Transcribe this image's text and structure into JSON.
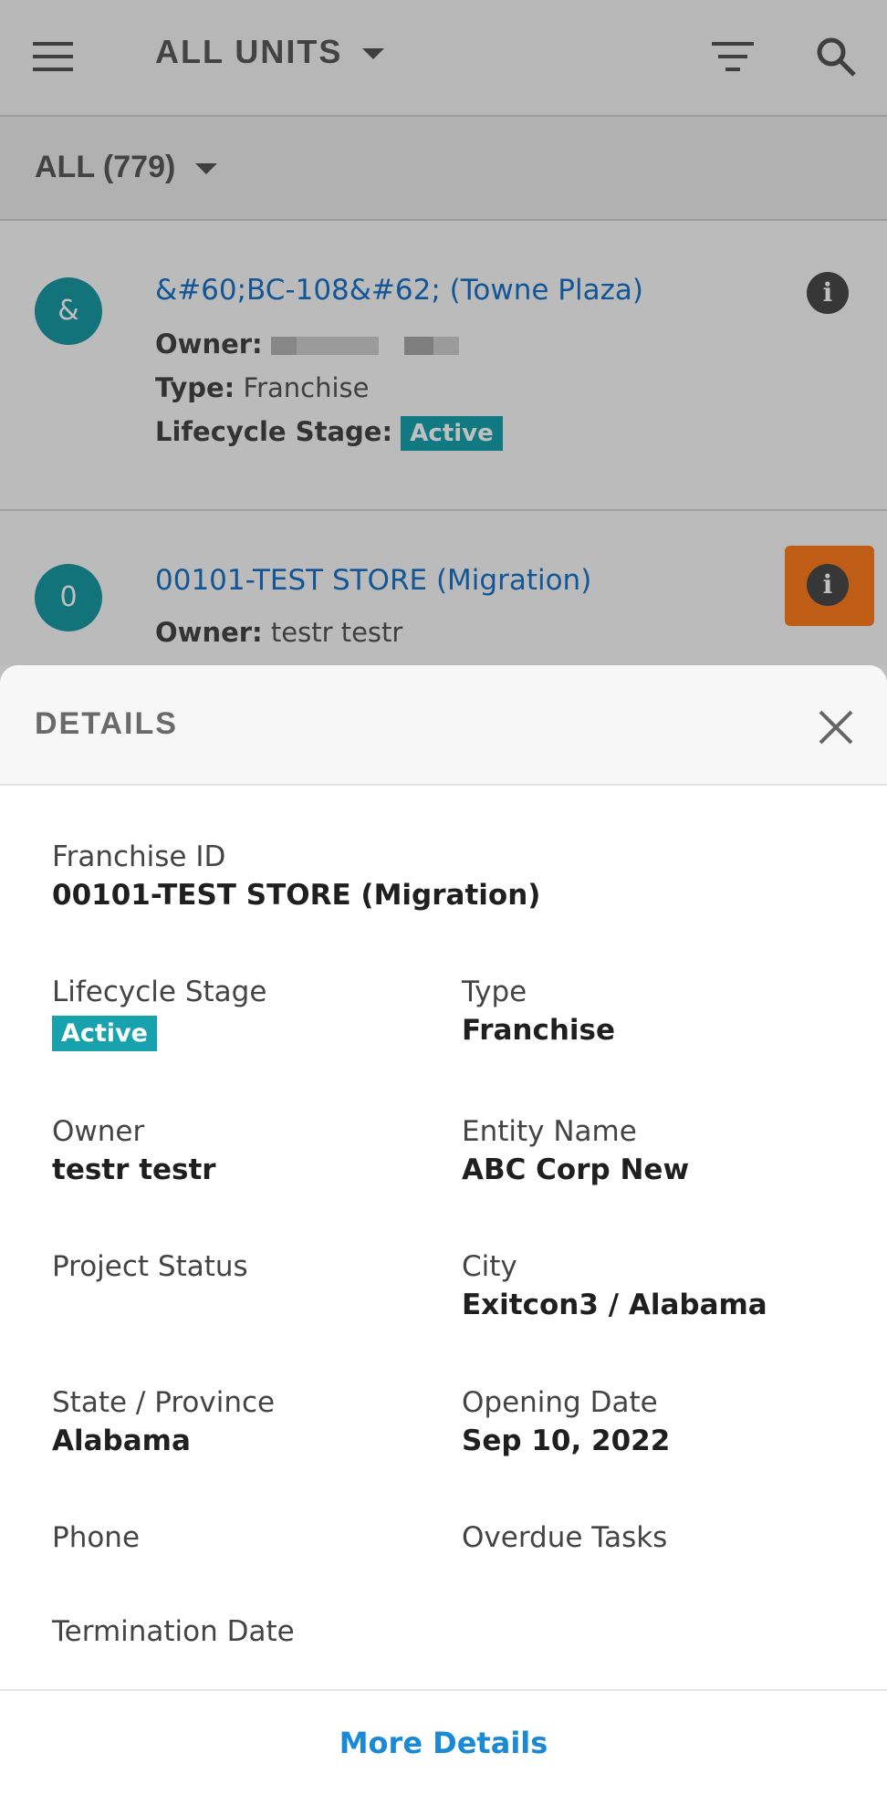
{
  "header": {
    "title": "ALL UNITS"
  },
  "filter_bar": {
    "label": "ALL (779)"
  },
  "list": [
    {
      "avatar": "&",
      "name": "&#60;BC-108&#62; (Towne Plaza)",
      "owner_label": "Owner:",
      "type_label": "Type:",
      "type_value": "Franchise",
      "lifecycle_label": "Lifecycle Stage:",
      "lifecycle_value": "Active"
    },
    {
      "avatar": "0",
      "name": "00101-TEST STORE (Migration)",
      "owner_label": "Owner:",
      "owner_value": "testr testr"
    }
  ],
  "details": {
    "title": "DETAILS",
    "franchise_id": {
      "label": "Franchise ID",
      "value": "00101-TEST STORE (Migration)"
    },
    "lifecycle": {
      "label": "Lifecycle Stage",
      "value": "Active"
    },
    "type": {
      "label": "Type",
      "value": "Franchise"
    },
    "owner": {
      "label": "Owner",
      "value": "testr testr"
    },
    "entity": {
      "label": "Entity Name",
      "value": "ABC Corp New"
    },
    "project_status": {
      "label": "Project Status"
    },
    "city": {
      "label": "City",
      "value": "Exitcon3 / Alabama"
    },
    "state": {
      "label": "State / Province",
      "value": "Alabama"
    },
    "opening_date": {
      "label": "Opening Date",
      "value": "Sep 10, 2022"
    },
    "phone": {
      "label": "Phone"
    },
    "overdue": {
      "label": "Overdue Tasks"
    },
    "termination": {
      "label": "Termination Date"
    },
    "more_details": "More Details"
  },
  "colors": {
    "accent": "#17a2ad",
    "link": "#1a73c9",
    "highlight": "#ff7c1f"
  },
  "icons": [
    "menu-icon",
    "filter-icon",
    "search-icon",
    "info-icon",
    "close-icon",
    "caret-down-icon"
  ]
}
